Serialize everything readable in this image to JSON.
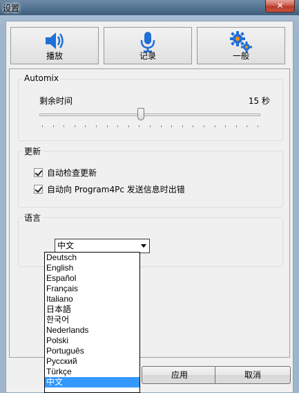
{
  "window": {
    "title": "设置",
    "close_label": "✕"
  },
  "tabs": [
    {
      "label": "播放",
      "icon": "speaker-icon",
      "active": false
    },
    {
      "label": "记录",
      "icon": "microphone-icon",
      "active": false
    },
    {
      "label": "一般",
      "icon": "gears-icon",
      "active": true
    }
  ],
  "automix": {
    "title": "Automix",
    "remaining_label": "剩余时间",
    "remaining_value": "15 秒",
    "slider_fraction": 0.46
  },
  "update": {
    "title": "更新",
    "auto_check_label": "自动检查更新",
    "auto_check_checked": true,
    "send_error_label": "自动向 Program4Pc 发送信息时出错",
    "send_error_checked": true
  },
  "language": {
    "title": "语言",
    "selected": "中文",
    "options": [
      "Deutsch",
      "English",
      "Español",
      "Français",
      "Italiano",
      "日本語",
      "한국어",
      "Nederlands",
      "Polski",
      "Português",
      "Русский",
      "Türkçe",
      "中文"
    ]
  },
  "buttons": {
    "apply": "应用",
    "cancel": "取消"
  },
  "colors": {
    "active_tab": "#ff8c00",
    "icon_blue": "#1f6fd6",
    "selection": "#3399ff"
  }
}
